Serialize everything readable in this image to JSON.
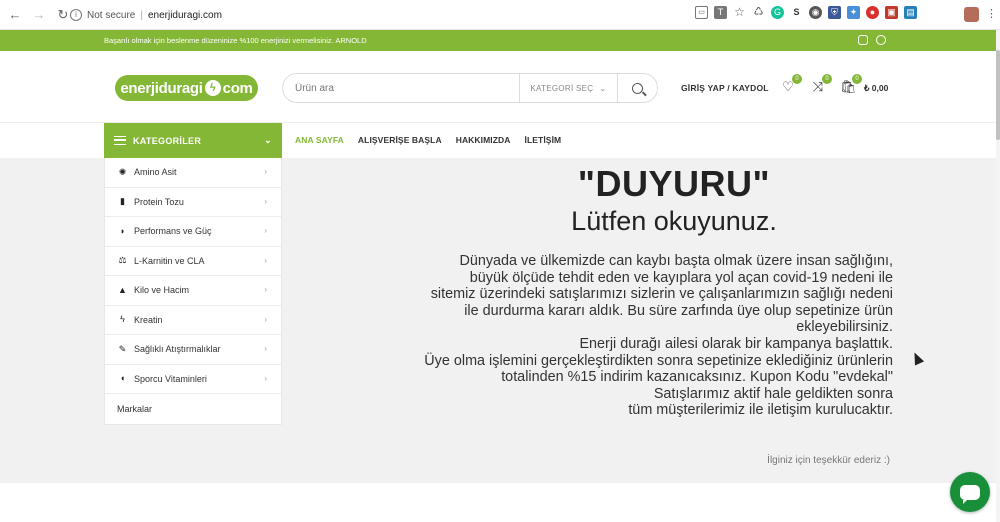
{
  "browser": {
    "security_label": "Not secure",
    "url": "enerjiduragi.com"
  },
  "topbar": {
    "promo": "Başarılı olmak için beslenme düzeninize %100 enerjinizi vermelisiniz. ARNOLD"
  },
  "header": {
    "logo_left": "enerjiduragi",
    "logo_right": "com",
    "search_placeholder": "Ürün ara",
    "category_select": "KATEGORİ SEÇ",
    "login": "GİRİŞ YAP / KAYDOL",
    "wishlist_count": "0",
    "compare_count": "0",
    "cart_count": "0",
    "cart_total": "₺ 0,00"
  },
  "nav": {
    "categories_label": "KATEGORİLER",
    "menu": [
      "ANA SAYFA",
      "ALIŞVERİŞE BAŞLA",
      "HAKKIMIZDA",
      "İLETİŞİM"
    ]
  },
  "categories": [
    {
      "label": "Amino Asit",
      "icon": "dna-icon"
    },
    {
      "label": "Protein Tozu",
      "icon": "protein-jar-icon"
    },
    {
      "label": "Performans ve Güç",
      "icon": "muscle-icon"
    },
    {
      "label": "L-Karnitin ve CLA",
      "icon": "scale-icon"
    },
    {
      "label": "Kilo ve Hacim",
      "icon": "weight-icon"
    },
    {
      "label": "Kreatin",
      "icon": "bolt-icon"
    },
    {
      "label": "Sağlıklı Atıştırmalıklar",
      "icon": "snack-icon"
    },
    {
      "label": "Sporcu Vitaminleri",
      "icon": "pill-icon"
    }
  ],
  "brands_label": "Markalar",
  "announcement": {
    "title": "\"DUYURU\"",
    "subtitle": "Lütfen okuyunuz.",
    "lines": [
      "Dünyada ve ülkemizde can kaybı başta olmak üzere insan sağlığını,",
      "büyük ölçüde tehdit eden ve kayıplara yol açan covid-19 nedeni ile",
      "sitemiz üzerindeki satışlarımızı sizlerin ve çalışanlarımızın sağlığı nedeni",
      "ile durdurma kararı aldık. Bu süre zarfında üye olup sepetinize ürün",
      "ekleyebilirsiniz.",
      "Enerji durağı ailesi olarak bir kampanya başlattık.",
      "Üye olma işlemini gerçekleştirdikten sonra sepetinize eklediğiniz ürünlerin",
      "totalinden %15 indirim kazanıcaksınız. Kupon Kodu \"evdekal\"",
      "Satışlarımız aktif hale geldikten sonra",
      "tüm müşterilerimiz ile iletişim kurulucaktır."
    ],
    "thanks": "İlginiz için teşekkür ederiz :)"
  },
  "colors": {
    "brand_green": "#83b735",
    "chat_green": "#1a8f3a"
  }
}
